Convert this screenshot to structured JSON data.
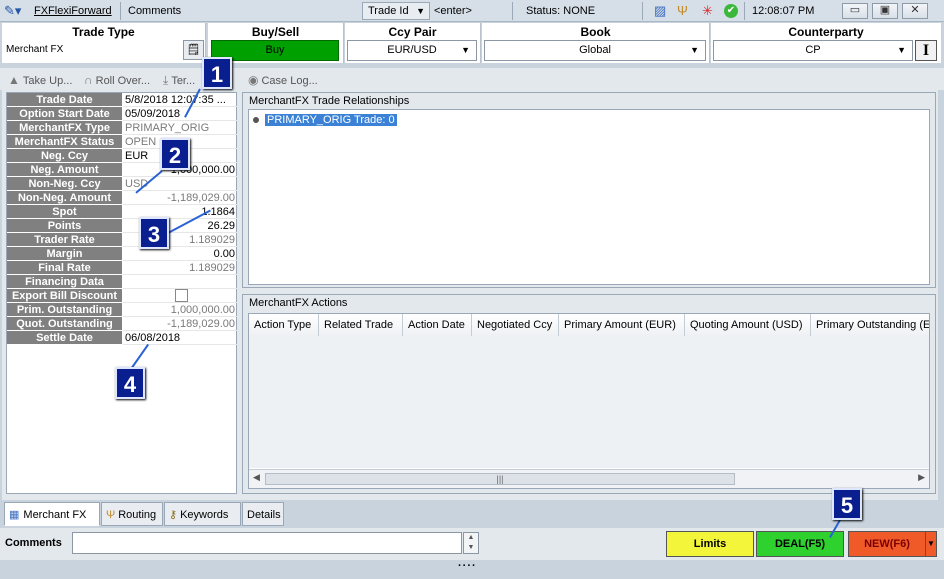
{
  "titlebar": {
    "app_link": "FXFlexiForward",
    "comments_tab": "Comments",
    "trade_id_label": "Trade Id",
    "trade_id_value": "<enter>",
    "status": "Status: NONE",
    "time": "12:08:07 PM"
  },
  "header": {
    "trade_type": {
      "title": "Trade Type",
      "value": "Merchant FX"
    },
    "buy_sell": {
      "title": "Buy/Sell",
      "value": "Buy"
    },
    "ccy_pair": {
      "title": "Ccy Pair",
      "value": "EUR/USD"
    },
    "book": {
      "title": "Book",
      "value": "Global"
    },
    "counterparty": {
      "title": "Counterparty",
      "value": "CP"
    }
  },
  "actions": [
    {
      "label": "Take Up..."
    },
    {
      "label": "Roll Over..."
    },
    {
      "label": "Ter..."
    },
    {
      "label": "Case Log..."
    }
  ],
  "fields": [
    {
      "label": "Trade Date",
      "value": "5/8/2018 12:07:35 ..."
    },
    {
      "label": "Option Start Date",
      "value": "05/09/2018"
    },
    {
      "label": "MerchantFX Type",
      "value": "PRIMARY_ORIG"
    },
    {
      "label": "MerchantFX Status",
      "value": "OPEN"
    },
    {
      "label": "Neg. Ccy",
      "value": "EUR"
    },
    {
      "label": "Neg. Amount",
      "value": "1,000,000.00"
    },
    {
      "label": "Non-Neg. Ccy",
      "value": "USD"
    },
    {
      "label": "Non-Neg. Amount",
      "value": "-1,189,029.00"
    },
    {
      "label": "Spot",
      "value": "1.1864"
    },
    {
      "label": "Points",
      "value": "26.29"
    },
    {
      "label": "Trader Rate",
      "value": "1.189029"
    },
    {
      "label": "Margin",
      "value": "0.00"
    },
    {
      "label": "Final Rate",
      "value": "1.189029"
    },
    {
      "label": "Financing Data",
      "value": ""
    },
    {
      "label": "Export Bill Discount",
      "value": ""
    },
    {
      "label": "Prim. Outstanding",
      "value": "1,000,000.00"
    },
    {
      "label": "Quot. Outstanding",
      "value": "-1,189,029.00"
    },
    {
      "label": "Settle Date",
      "value": "06/08/2018"
    }
  ],
  "relationships": {
    "title": "MerchantFX Trade Relationships",
    "items": [
      "PRIMARY_ORIG Trade: 0"
    ]
  },
  "actions_table": {
    "title": "MerchantFX Actions",
    "columns": [
      "Action Type",
      "Related Trade",
      "Action Date",
      "Negotiated Ccy",
      "Primary Amount (EUR)",
      "Quoting Amount (USD)",
      "Primary Outstanding (E"
    ]
  },
  "bottom_tabs": [
    "Merchant FX",
    "Routing",
    "Keywords",
    "Details"
  ],
  "comments": {
    "label": "Comments",
    "value": ""
  },
  "buttons": {
    "limits": "Limits",
    "deal": "DEAL(F5)",
    "new": "NEW(F6)"
  },
  "markers": [
    "1",
    "2",
    "3",
    "4",
    "5"
  ],
  "colors": {
    "buy": "#00a000",
    "limits": "#f2f53a",
    "deal": "#2ed12e",
    "new": "#f05a28",
    "marker": "#0a1f8f"
  }
}
